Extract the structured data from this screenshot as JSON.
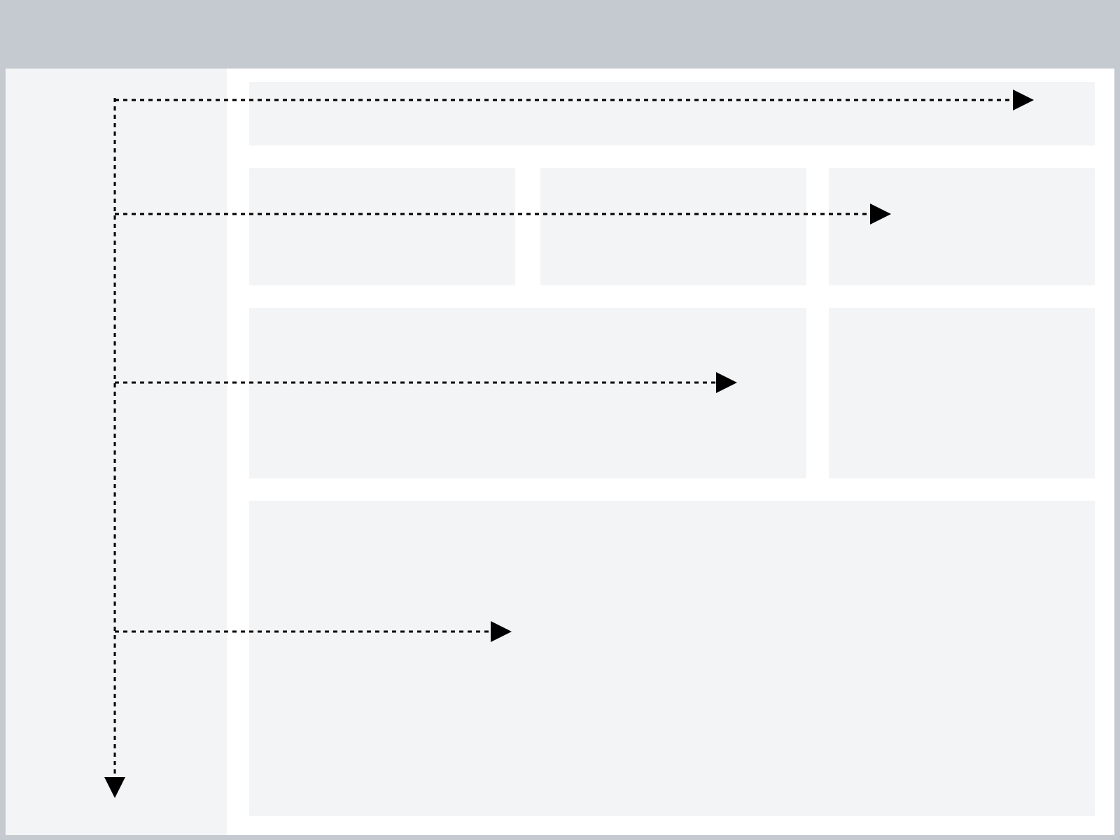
{
  "diagram": {
    "kind": "wireframe-reading-pattern",
    "regions": [
      {
        "id": "header",
        "fill": "#c5c9d0"
      },
      {
        "id": "sidebar",
        "fill": "#f3f4f6"
      },
      {
        "id": "content",
        "fill": "#ffffff"
      }
    ],
    "blocks": [
      {
        "id": "hero"
      },
      {
        "id": "row2-card-1"
      },
      {
        "id": "row2-card-2"
      },
      {
        "id": "row2-card-3"
      },
      {
        "id": "row3-wide"
      },
      {
        "id": "row3-narrow"
      },
      {
        "id": "row4-large"
      }
    ],
    "arrows": {
      "style": "dotted",
      "color": "#000000",
      "count_horizontal": 4,
      "count_vertical": 1
    },
    "colors": {
      "frame": "#c5c9d0",
      "panel": "#f3f4f6",
      "background": "#ffffff",
      "stroke": "#000000"
    }
  }
}
